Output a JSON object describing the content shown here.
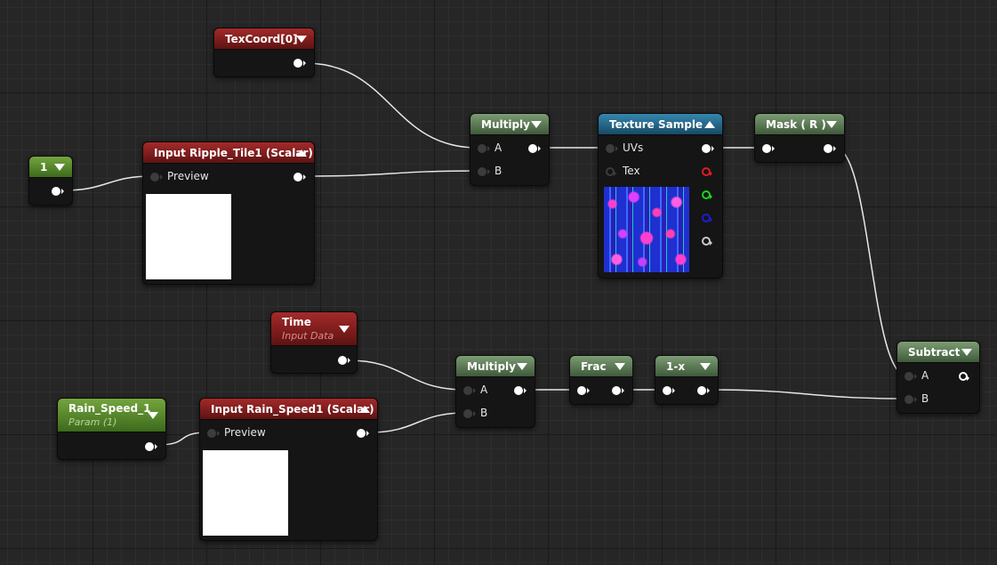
{
  "nodes": {
    "texcoord": {
      "title": "TexCoord[0]"
    },
    "multiply_top": {
      "title": "Multiply",
      "pin_a": "A",
      "pin_b": "B"
    },
    "texture_sample": {
      "title": "Texture Sample",
      "pin_uvs": "UVs",
      "pin_tex": "Tex"
    },
    "mask": {
      "title": "Mask ( R )"
    },
    "const_one": {
      "title": "1"
    },
    "ripple_tile": {
      "title": "Input Ripple_Tile1 (Scalar)",
      "pin_preview": "Preview"
    },
    "time": {
      "title": "Time",
      "subtitle": "Input Data"
    },
    "multiply_bottom": {
      "title": "Multiply",
      "pin_a": "A",
      "pin_b": "B"
    },
    "frac": {
      "title": "Frac"
    },
    "one_minus_x": {
      "title": "1-x"
    },
    "subtract": {
      "title": "Subtract",
      "pin_a": "A",
      "pin_b": "B"
    },
    "rain_speed": {
      "title": "Rain_Speed_1",
      "subtitle": "Param (1)"
    },
    "rain_speed_input": {
      "title": "Input Rain_Speed1 (Scalar)",
      "pin_preview": "Preview"
    }
  },
  "colors": {
    "wire": "#e8e8e8",
    "param_header": "#a42a2a",
    "math_header": "#7c9c74",
    "texture_header": "#3586ad",
    "constant_header": "#74a53e",
    "grid_background": "#262626"
  }
}
